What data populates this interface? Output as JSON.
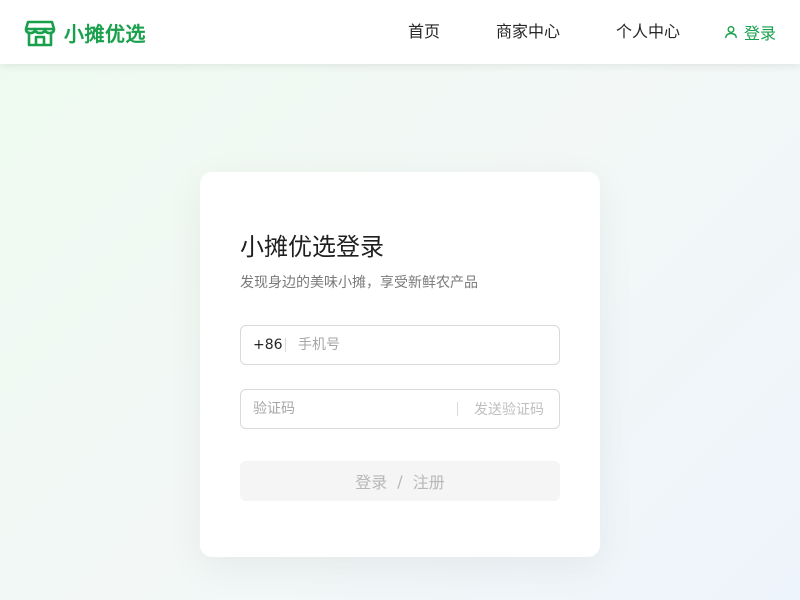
{
  "colors": {
    "brand": "#18a04c",
    "text_primary": "#262626",
    "placeholder": "#a6a6a6",
    "disabled_text": "#b8b8b8",
    "disabled_bg": "#f5f5f5"
  },
  "header": {
    "brand_name": "小摊优选",
    "brand_icon": "storefront-icon",
    "nav": {
      "home": "首页",
      "merchant_center": "商家中心",
      "personal_center": "个人中心",
      "login": "登录",
      "login_icon": "user-icon"
    }
  },
  "login_card": {
    "title": "小摊优选登录",
    "subtitle": "发现身边的美味小摊，享受新鲜农产品",
    "phone": {
      "prefix": "+86",
      "placeholder": "手机号",
      "value": ""
    },
    "code": {
      "placeholder": "验证码",
      "value": "",
      "send_label": "发送验证码"
    },
    "submit": {
      "login_label": "登录",
      "separator": "/",
      "register_label": "注册"
    }
  }
}
